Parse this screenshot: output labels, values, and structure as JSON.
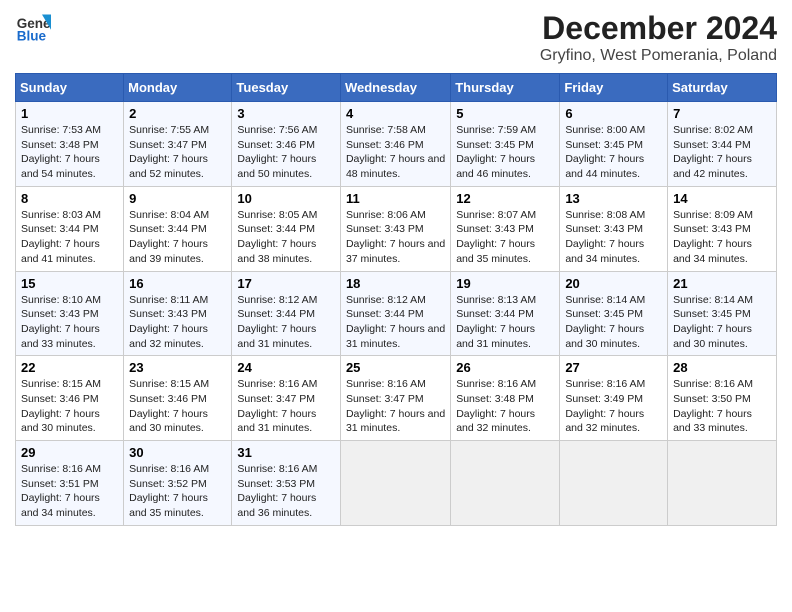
{
  "header": {
    "logo_line1": "General",
    "logo_line2": "Blue",
    "title": "December 2024",
    "subtitle": "Gryfino, West Pomerania, Poland"
  },
  "calendar": {
    "days_of_week": [
      "Sunday",
      "Monday",
      "Tuesday",
      "Wednesday",
      "Thursday",
      "Friday",
      "Saturday"
    ],
    "weeks": [
      [
        {
          "day": 1,
          "sunrise": "7:53 AM",
          "sunset": "3:48 PM",
          "daylight": "7 hours and 54 minutes"
        },
        {
          "day": 2,
          "sunrise": "7:55 AM",
          "sunset": "3:47 PM",
          "daylight": "7 hours and 52 minutes"
        },
        {
          "day": 3,
          "sunrise": "7:56 AM",
          "sunset": "3:46 PM",
          "daylight": "7 hours and 50 minutes"
        },
        {
          "day": 4,
          "sunrise": "7:58 AM",
          "sunset": "3:46 PM",
          "daylight": "7 hours and 48 minutes"
        },
        {
          "day": 5,
          "sunrise": "7:59 AM",
          "sunset": "3:45 PM",
          "daylight": "7 hours and 46 minutes"
        },
        {
          "day": 6,
          "sunrise": "8:00 AM",
          "sunset": "3:45 PM",
          "daylight": "7 hours and 44 minutes"
        },
        {
          "day": 7,
          "sunrise": "8:02 AM",
          "sunset": "3:44 PM",
          "daylight": "7 hours and 42 minutes"
        }
      ],
      [
        {
          "day": 8,
          "sunrise": "8:03 AM",
          "sunset": "3:44 PM",
          "daylight": "7 hours and 41 minutes"
        },
        {
          "day": 9,
          "sunrise": "8:04 AM",
          "sunset": "3:44 PM",
          "daylight": "7 hours and 39 minutes"
        },
        {
          "day": 10,
          "sunrise": "8:05 AM",
          "sunset": "3:44 PM",
          "daylight": "7 hours and 38 minutes"
        },
        {
          "day": 11,
          "sunrise": "8:06 AM",
          "sunset": "3:43 PM",
          "daylight": "7 hours and 37 minutes"
        },
        {
          "day": 12,
          "sunrise": "8:07 AM",
          "sunset": "3:43 PM",
          "daylight": "7 hours and 35 minutes"
        },
        {
          "day": 13,
          "sunrise": "8:08 AM",
          "sunset": "3:43 PM",
          "daylight": "7 hours and 34 minutes"
        },
        {
          "day": 14,
          "sunrise": "8:09 AM",
          "sunset": "3:43 PM",
          "daylight": "7 hours and 34 minutes"
        }
      ],
      [
        {
          "day": 15,
          "sunrise": "8:10 AM",
          "sunset": "3:43 PM",
          "daylight": "7 hours and 33 minutes"
        },
        {
          "day": 16,
          "sunrise": "8:11 AM",
          "sunset": "3:43 PM",
          "daylight": "7 hours and 32 minutes"
        },
        {
          "day": 17,
          "sunrise": "8:12 AM",
          "sunset": "3:44 PM",
          "daylight": "7 hours and 31 minutes"
        },
        {
          "day": 18,
          "sunrise": "8:12 AM",
          "sunset": "3:44 PM",
          "daylight": "7 hours and 31 minutes"
        },
        {
          "day": 19,
          "sunrise": "8:13 AM",
          "sunset": "3:44 PM",
          "daylight": "7 hours and 31 minutes"
        },
        {
          "day": 20,
          "sunrise": "8:14 AM",
          "sunset": "3:45 PM",
          "daylight": "7 hours and 30 minutes"
        },
        {
          "day": 21,
          "sunrise": "8:14 AM",
          "sunset": "3:45 PM",
          "daylight": "7 hours and 30 minutes"
        }
      ],
      [
        {
          "day": 22,
          "sunrise": "8:15 AM",
          "sunset": "3:46 PM",
          "daylight": "7 hours and 30 minutes"
        },
        {
          "day": 23,
          "sunrise": "8:15 AM",
          "sunset": "3:46 PM",
          "daylight": "7 hours and 30 minutes"
        },
        {
          "day": 24,
          "sunrise": "8:16 AM",
          "sunset": "3:47 PM",
          "daylight": "7 hours and 31 minutes"
        },
        {
          "day": 25,
          "sunrise": "8:16 AM",
          "sunset": "3:47 PM",
          "daylight": "7 hours and 31 minutes"
        },
        {
          "day": 26,
          "sunrise": "8:16 AM",
          "sunset": "3:48 PM",
          "daylight": "7 hours and 32 minutes"
        },
        {
          "day": 27,
          "sunrise": "8:16 AM",
          "sunset": "3:49 PM",
          "daylight": "7 hours and 32 minutes"
        },
        {
          "day": 28,
          "sunrise": "8:16 AM",
          "sunset": "3:50 PM",
          "daylight": "7 hours and 33 minutes"
        }
      ],
      [
        {
          "day": 29,
          "sunrise": "8:16 AM",
          "sunset": "3:51 PM",
          "daylight": "7 hours and 34 minutes"
        },
        {
          "day": 30,
          "sunrise": "8:16 AM",
          "sunset": "3:52 PM",
          "daylight": "7 hours and 35 minutes"
        },
        {
          "day": 31,
          "sunrise": "8:16 AM",
          "sunset": "3:53 PM",
          "daylight": "7 hours and 36 minutes"
        },
        null,
        null,
        null,
        null
      ]
    ]
  }
}
